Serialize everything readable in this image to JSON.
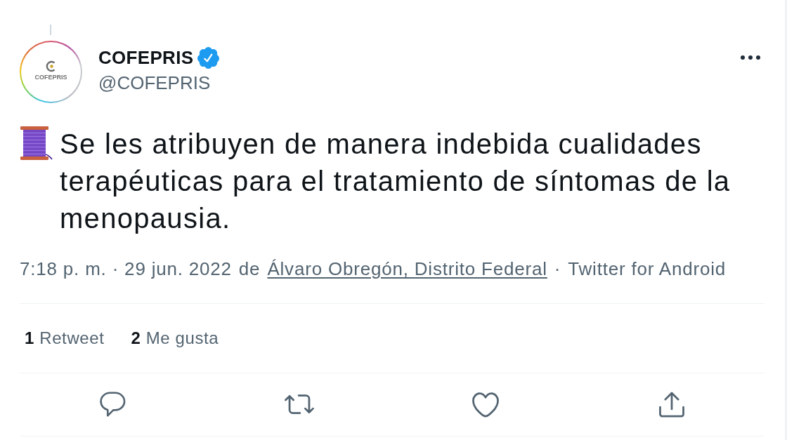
{
  "tweet": {
    "thread_above": true,
    "avatar": {
      "logo_text": "COFEPRIS"
    },
    "author": {
      "name": "COFEPRIS",
      "verified": true,
      "handle": "@COFEPRIS"
    },
    "text": "Se les atribuyen de manera indebida cualidades terapéuticas para el tratamiento de síntomas de la menopausia.",
    "meta": {
      "timestamp": "7:18 p. m. · 29 jun. 2022",
      "location_prefix": "de",
      "location": "Álvaro Obregón, Distrito Federal",
      "separator": "·",
      "source": "Twitter for Android"
    },
    "stats": [
      {
        "count": "1",
        "label": "Retweet"
      },
      {
        "count": "2",
        "label": "Me gusta"
      }
    ],
    "actions": [
      {
        "kind": "reply"
      },
      {
        "kind": "retweet"
      },
      {
        "kind": "like"
      },
      {
        "kind": "share"
      }
    ]
  }
}
